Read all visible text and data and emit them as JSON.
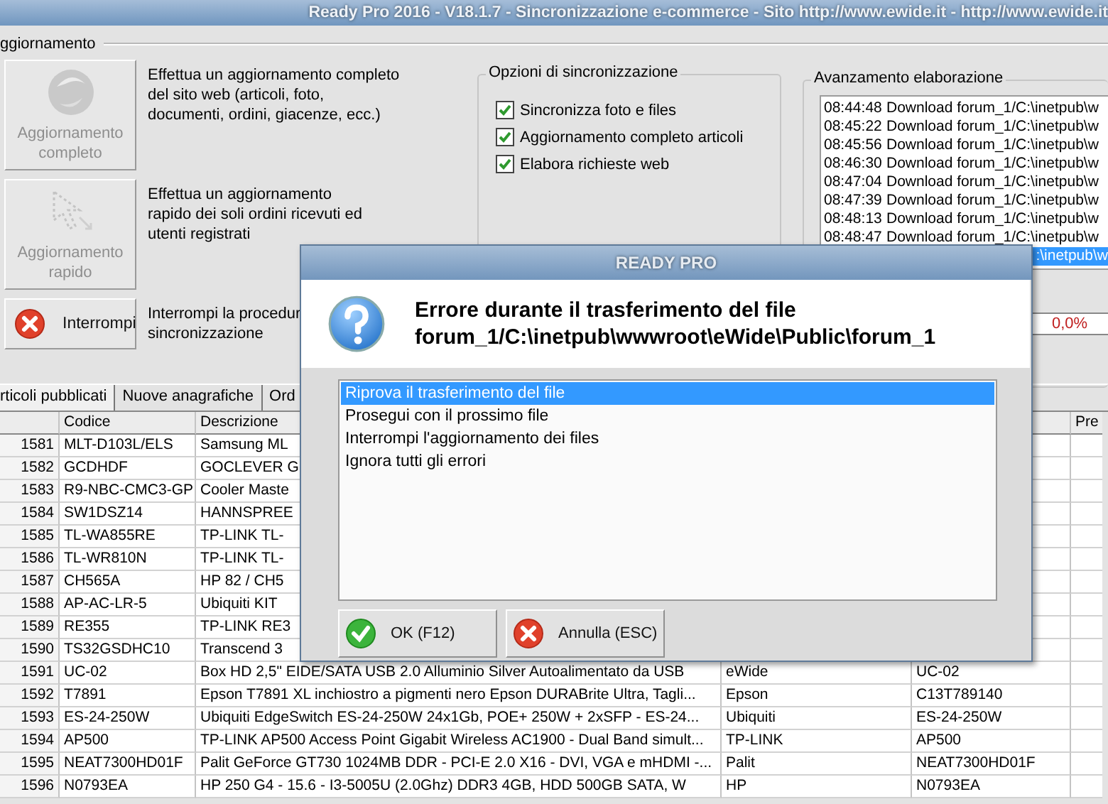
{
  "window": {
    "title": "Ready Pro 2016 - V18.1.7 - Sincronizzazione e-commerce - Sito http://www.ewide.it - http://www.ewide.it"
  },
  "update_group": {
    "title": "ggiornamento",
    "actions": [
      {
        "kind": "full",
        "label": "Aggiornamento completo",
        "disabled": true,
        "lines": [
          "Effettua un aggiornamento completo",
          "del sito web (articoli, foto,",
          "documenti, ordini, giacenze, ecc.)"
        ]
      },
      {
        "kind": "quick",
        "label": "Aggiornamento rapido",
        "disabled": true,
        "lines": [
          "Effettua un aggiornamento",
          "rapido dei soli ordini ricevuti ed",
          "utenti registrati"
        ]
      },
      {
        "kind": "stop",
        "label": "Interrompi",
        "disabled": false,
        "lines": [
          "Interrompi la procedur",
          "sincronizzazione"
        ]
      }
    ]
  },
  "options": {
    "title": "Opzioni di sincronizzazione",
    "items": [
      {
        "label": "Sincronizza foto e files",
        "checked": true
      },
      {
        "label": "Aggiornamento completo articoli",
        "checked": true
      },
      {
        "label": "Elabora richieste web",
        "checked": true
      }
    ]
  },
  "log": {
    "title": "Avanzamento elaborazione",
    "rows": [
      {
        "time": "08:44:48",
        "text": "Download forum_1/C:\\inetpub\\w",
        "selected": false
      },
      {
        "time": "08:45:22",
        "text": "Download forum_1/C:\\inetpub\\w",
        "selected": false
      },
      {
        "time": "08:45:56",
        "text": "Download forum_1/C:\\inetpub\\w",
        "selected": false
      },
      {
        "time": "08:46:30",
        "text": "Download forum_1/C:\\inetpub\\w",
        "selected": false
      },
      {
        "time": "08:47:04",
        "text": "Download forum_1/C:\\inetpub\\w",
        "selected": false
      },
      {
        "time": "08:47:39",
        "text": "Download forum_1/C:\\inetpub\\w",
        "selected": false
      },
      {
        "time": "08:48:13",
        "text": "Download forum_1/C:\\inetpub\\w",
        "selected": false
      },
      {
        "time": "08:48:47",
        "text": "Download forum_1/C:\\inetpub\\w",
        "selected": false
      },
      {
        "text": ":\\inetpub\\w",
        "selected": true
      }
    ]
  },
  "progress": {
    "level": 0,
    "reading": "0,0%"
  },
  "tabs": [
    {
      "label": "rticoli pubblicati",
      "selected": true
    },
    {
      "label": "Nuove anagrafiche",
      "selected": false
    },
    {
      "label": "Ord",
      "selected": false
    }
  ],
  "table": {
    "columns": {
      "codice": "Codice",
      "descrizione": "Descrizione",
      "column_6": "Pre"
    },
    "rows": [
      {
        "number": "1581",
        "codice": "MLT-D103L/ELS",
        "descrizione": "Samsung ML"
      },
      {
        "number": "1582",
        "codice": "GCDHDF",
        "descrizione": "GOCLEVER G"
      },
      {
        "number": "1583",
        "codice": "R9-NBC-CMC3-GP",
        "descrizione": "Cooler Maste"
      },
      {
        "number": "1584",
        "codice": "SW1DSZ14",
        "descrizione": "HANNSPREE"
      },
      {
        "number": "1585",
        "codice": "TL-WA855RE",
        "descrizione": "TP-LINK TL-"
      },
      {
        "number": "1586",
        "codice": "TL-WR810N",
        "descrizione": "TP-LINK TL-"
      },
      {
        "number": "1587",
        "codice": "CH565A",
        "descrizione": "HP 82 / CH5"
      },
      {
        "number": "1588",
        "codice": "AP-AC-LR-5",
        "descrizione": "Ubiquiti KIT"
      },
      {
        "number": "1589",
        "codice": "RE355",
        "descrizione": "TP-LINK RE3"
      },
      {
        "number": "1590",
        "codice": "TS32GSDHC10",
        "descrizione": "Transcend 3"
      },
      {
        "number": "1591",
        "codice": "UC-02",
        "descrizione": "Box HD 2,5\" EIDE/SATA USB 2.0 Alluminio Silver Autoalimentato da USB",
        "column_4": "eWide",
        "column_5": "UC-02"
      },
      {
        "number": "1592",
        "codice": "T7891",
        "descrizione": "Epson T7891 XL inchiostro a pigmenti nero Epson DURABrite Ultra, Tagli...",
        "column_4": "Epson",
        "column_5": "C13T789140"
      },
      {
        "number": "1593",
        "codice": "ES-24-250W",
        "descrizione": "Ubiquiti EdgeSwitch ES-24-250W 24x1Gb, POE+ 250W + 2xSFP - ES-24...",
        "column_4": "Ubiquiti",
        "column_5": "ES-24-250W"
      },
      {
        "number": "1594",
        "codice": "AP500",
        "descrizione": "TP-LINK AP500 Access Point Gigabit Wireless AC1900 - Dual Band simult...",
        "column_4": "TP-LINK",
        "column_5": "AP500"
      },
      {
        "number": "1595",
        "codice": "NEAT7300HD01F",
        "descrizione": "Palit GeForce GT730 1024MB DDR - PCI-E 2.0 X16 - DVI, VGA e mHDMI -...",
        "column_4": "Palit",
        "column_5": "NEAT7300HD01F"
      },
      {
        "number": "1596",
        "codice": "N0793EA",
        "descrizione": "HP 250 G4 - 15.6 - I3-5005U (2.0Ghz) DDR3 4GB, HDD 500GB SATA, W",
        "column_4": "HP",
        "column_5": "N0793EA"
      }
    ]
  },
  "dialog": {
    "title": "READY PRO",
    "message": [
      "Errore durante il trasferimento del file",
      "forum_1/C:\\inetpub\\wwwroot\\eWide\\Public\\forum_1"
    ],
    "options": [
      {
        "label": "Riprova il trasferimento del file",
        "selected": true
      },
      {
        "label": "Prosegui con il prossimo file",
        "selected": false
      },
      {
        "label": "Interrompi l'aggiornamento dei files",
        "selected": false
      },
      {
        "label": "Ignora tutti gli errori",
        "selected": false
      }
    ],
    "buttons": [
      {
        "kind": "ok",
        "label": "OK (F12)"
      },
      {
        "kind": "cancel",
        "label": "Annulla (ESC)"
      }
    ]
  }
}
